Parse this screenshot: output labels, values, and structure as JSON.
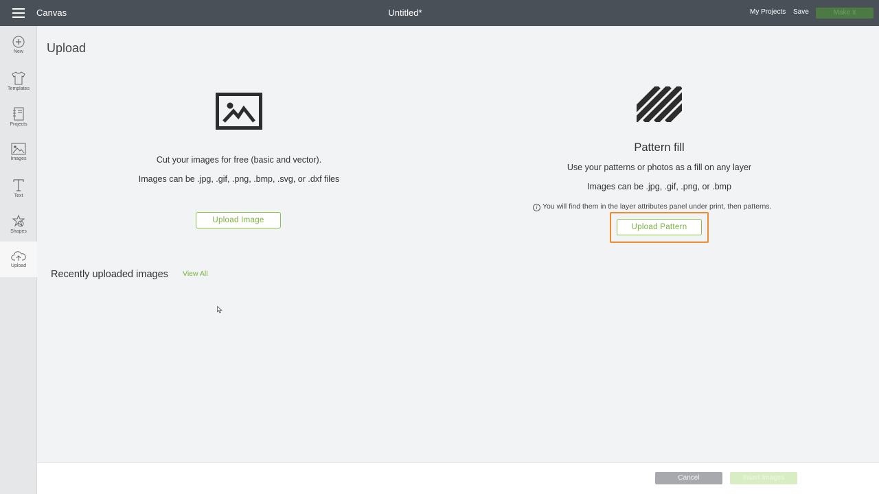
{
  "topbar": {
    "app_name": "Canvas",
    "doc_title": "Untitled*",
    "my_projects": "My Projects",
    "save": "Save",
    "make_it": "Make It"
  },
  "sidebar": {
    "items": [
      {
        "label": "New",
        "icon": "plus-circle-icon"
      },
      {
        "label": "Templates",
        "icon": "tshirt-icon"
      },
      {
        "label": "Projects",
        "icon": "notebook-icon"
      },
      {
        "label": "Images",
        "icon": "image-icon"
      },
      {
        "label": "Text",
        "icon": "text-icon"
      },
      {
        "label": "Shapes",
        "icon": "shapes-icon"
      },
      {
        "label": "Upload",
        "icon": "cloud-upload-icon",
        "active": true
      }
    ]
  },
  "main": {
    "title": "Upload",
    "image_upload": {
      "desc1": "Cut your images for free (basic and vector).",
      "desc2": "Images can be .jpg, .gif, .png, .bmp, .svg, or .dxf files",
      "button": "Upload Image"
    },
    "pattern_upload": {
      "title": "Pattern fill",
      "desc1": "Use your patterns or photos as a fill on any layer",
      "desc2": "Images can be .jpg, .gif, .png, or .bmp",
      "note": "You will find them in the layer attributes panel under print, then patterns.",
      "info_glyph": "i",
      "button": "Upload Pattern"
    },
    "recent": {
      "title": "Recently uploaded images",
      "view_all": "View All"
    }
  },
  "footer": {
    "cancel": "Cancel",
    "insert": "Insert Images"
  },
  "colors": {
    "topbar": "#4a5058",
    "accent_green": "#7ab03c",
    "highlight_orange": "#ef8a2f"
  }
}
